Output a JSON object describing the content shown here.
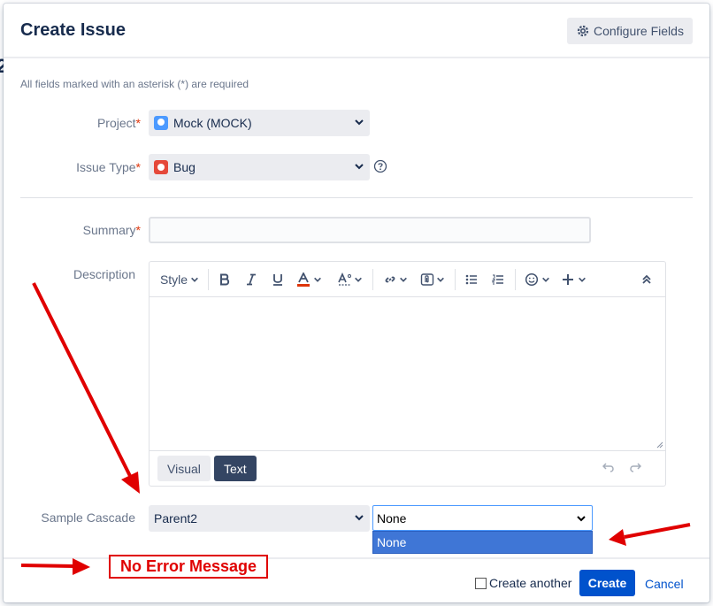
{
  "dialog": {
    "title": "Create Issue",
    "configure_fields_label": "Configure Fields",
    "required_note": "All fields marked with an asterisk (*) are required"
  },
  "fields": {
    "project": {
      "label": "Project",
      "asterisk": "*",
      "value": "Mock (MOCK)"
    },
    "issue_type": {
      "label": "Issue Type",
      "asterisk": "*",
      "value": "Bug"
    },
    "summary": {
      "label": "Summary",
      "asterisk": "*",
      "value": ""
    },
    "description": {
      "label": "Description"
    },
    "sample_cascade": {
      "label": "Sample Cascade",
      "parent_value": "Parent2",
      "child_value": "None",
      "child_options": [
        "None"
      ]
    }
  },
  "editor": {
    "style_label": "Style",
    "mode_visual": "Visual",
    "mode_text": "Text",
    "toolbar_icons": [
      "bold-icon",
      "italic-icon",
      "underline-icon",
      "text-color-icon",
      "text-format-icon",
      "link-icon",
      "attachment-icon",
      "bullet-list-icon",
      "numbered-list-icon",
      "emoji-icon",
      "insert-more-icon",
      "collapse-toolbar-icon",
      "undo-icon",
      "redo-icon"
    ]
  },
  "footer": {
    "create_another_label": "Create another",
    "create_label": "Create",
    "cancel_label": "Cancel"
  },
  "annotation": {
    "message": "No Error Message",
    "color": "#e00000"
  },
  "colors": {
    "primary": "#0052cc",
    "required": "#de350b",
    "dark_button": "#344563",
    "dropdown_selected": "#3f76d6"
  }
}
